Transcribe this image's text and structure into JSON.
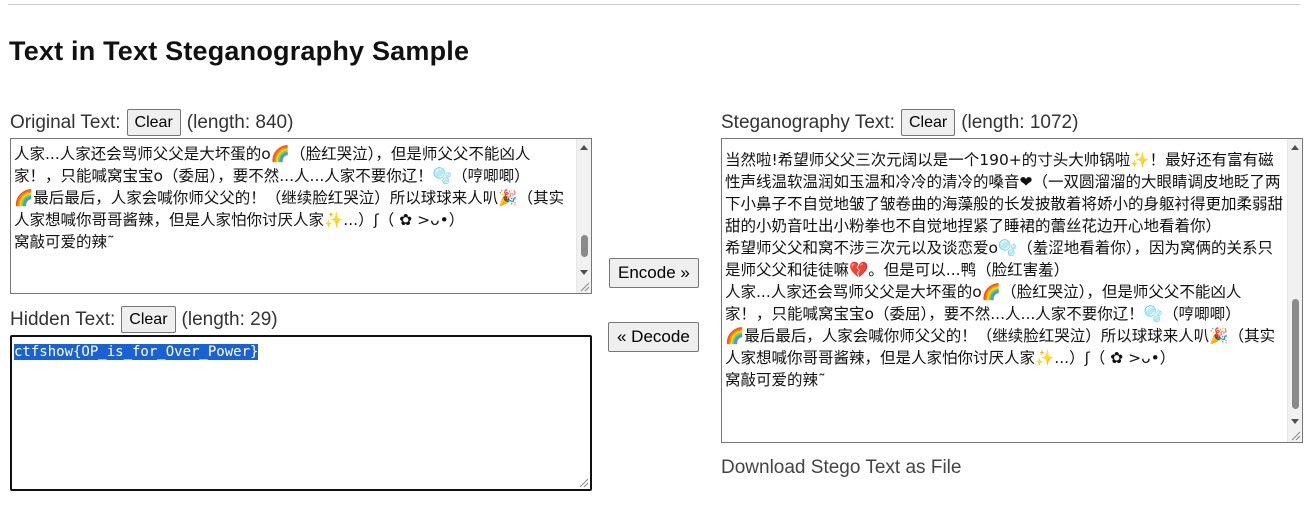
{
  "page": {
    "title": "Text in Text Steganography Sample"
  },
  "original": {
    "label": "Original Text:",
    "clear_label": "Clear",
    "length_text": "(length: 840)",
    "lines": [
      "人家...人家还会骂师父父是大坏蛋的o🌈（脸红哭泣），但是师父父不能凶人家！，只能喊窝宝宝o（委屈），要不然...人...人家不要你辽！🫧（哼唧唧）",
      "🌈最后最后，人家会喊你师父父的！（继续脸红哭泣）所以球球来人叭🎉（其实人家想喊你哥哥酱辣，但是人家怕你讨厌人家✨...）ʃ（ ✿ >ᴗ•）",
      "窝敲可爱的辣˜"
    ]
  },
  "buttons": {
    "encode_label": "Encode »",
    "decode_label": "« Decode"
  },
  "hidden": {
    "label": "Hidden Text:",
    "clear_label": "Clear",
    "length_text": "(length: 29)",
    "value": "ctfshow{OP_is_for_Over_Power}"
  },
  "stego": {
    "label": "Steganography Text:",
    "clear_label": "Clear",
    "length_text": "(length: 1072)",
    "lines": [
      "当然啦!希望师父父三次元阔以是一个190+的寸头大帅锅啦✨！最好还有富有磁性声线温软温润如玉温和冷冷的清冷的嗓音❤（一双圆溜溜的大眼睛调皮地眨了两下小鼻子不自觉地皱了皱卷曲的海藻般的长发披散着将娇小的身躯衬得更加柔弱甜甜的小奶音吐出小粉拳也不自觉地捏紧了睡裙的蕾丝花边开心地看着你）",
      "希望师父父和窝不涉三次元以及谈恋爱o🫧（羞涩地看着你），因为窝俩的关系只是师父父和徒徒嘛💔。但是可以...鸭（脸红害羞）",
      "人家...人家还会骂师父父是大坏蛋的o🌈（脸红哭泣），但是师父父不能凶人家！，只能喊窝宝宝o（委屈），要不然...人...人家不要你辽！🫧（哼唧唧）",
      "🌈最后最后，人家会喊你师父父的！（继续脸红哭泣）所以球球来人叭🎉（其实人家想喊你哥哥酱辣，但是人家怕你讨厌人家✨...）ʃ（ ✿ >ᴗ•）",
      "窝敲可爱的辣˜"
    ]
  },
  "download": {
    "label": "Download Stego Text as File"
  },
  "icons": {
    "scroll_up": "triangle-up-icon",
    "scroll_down": "triangle-down-icon",
    "resize": "resize-grip-icon"
  }
}
